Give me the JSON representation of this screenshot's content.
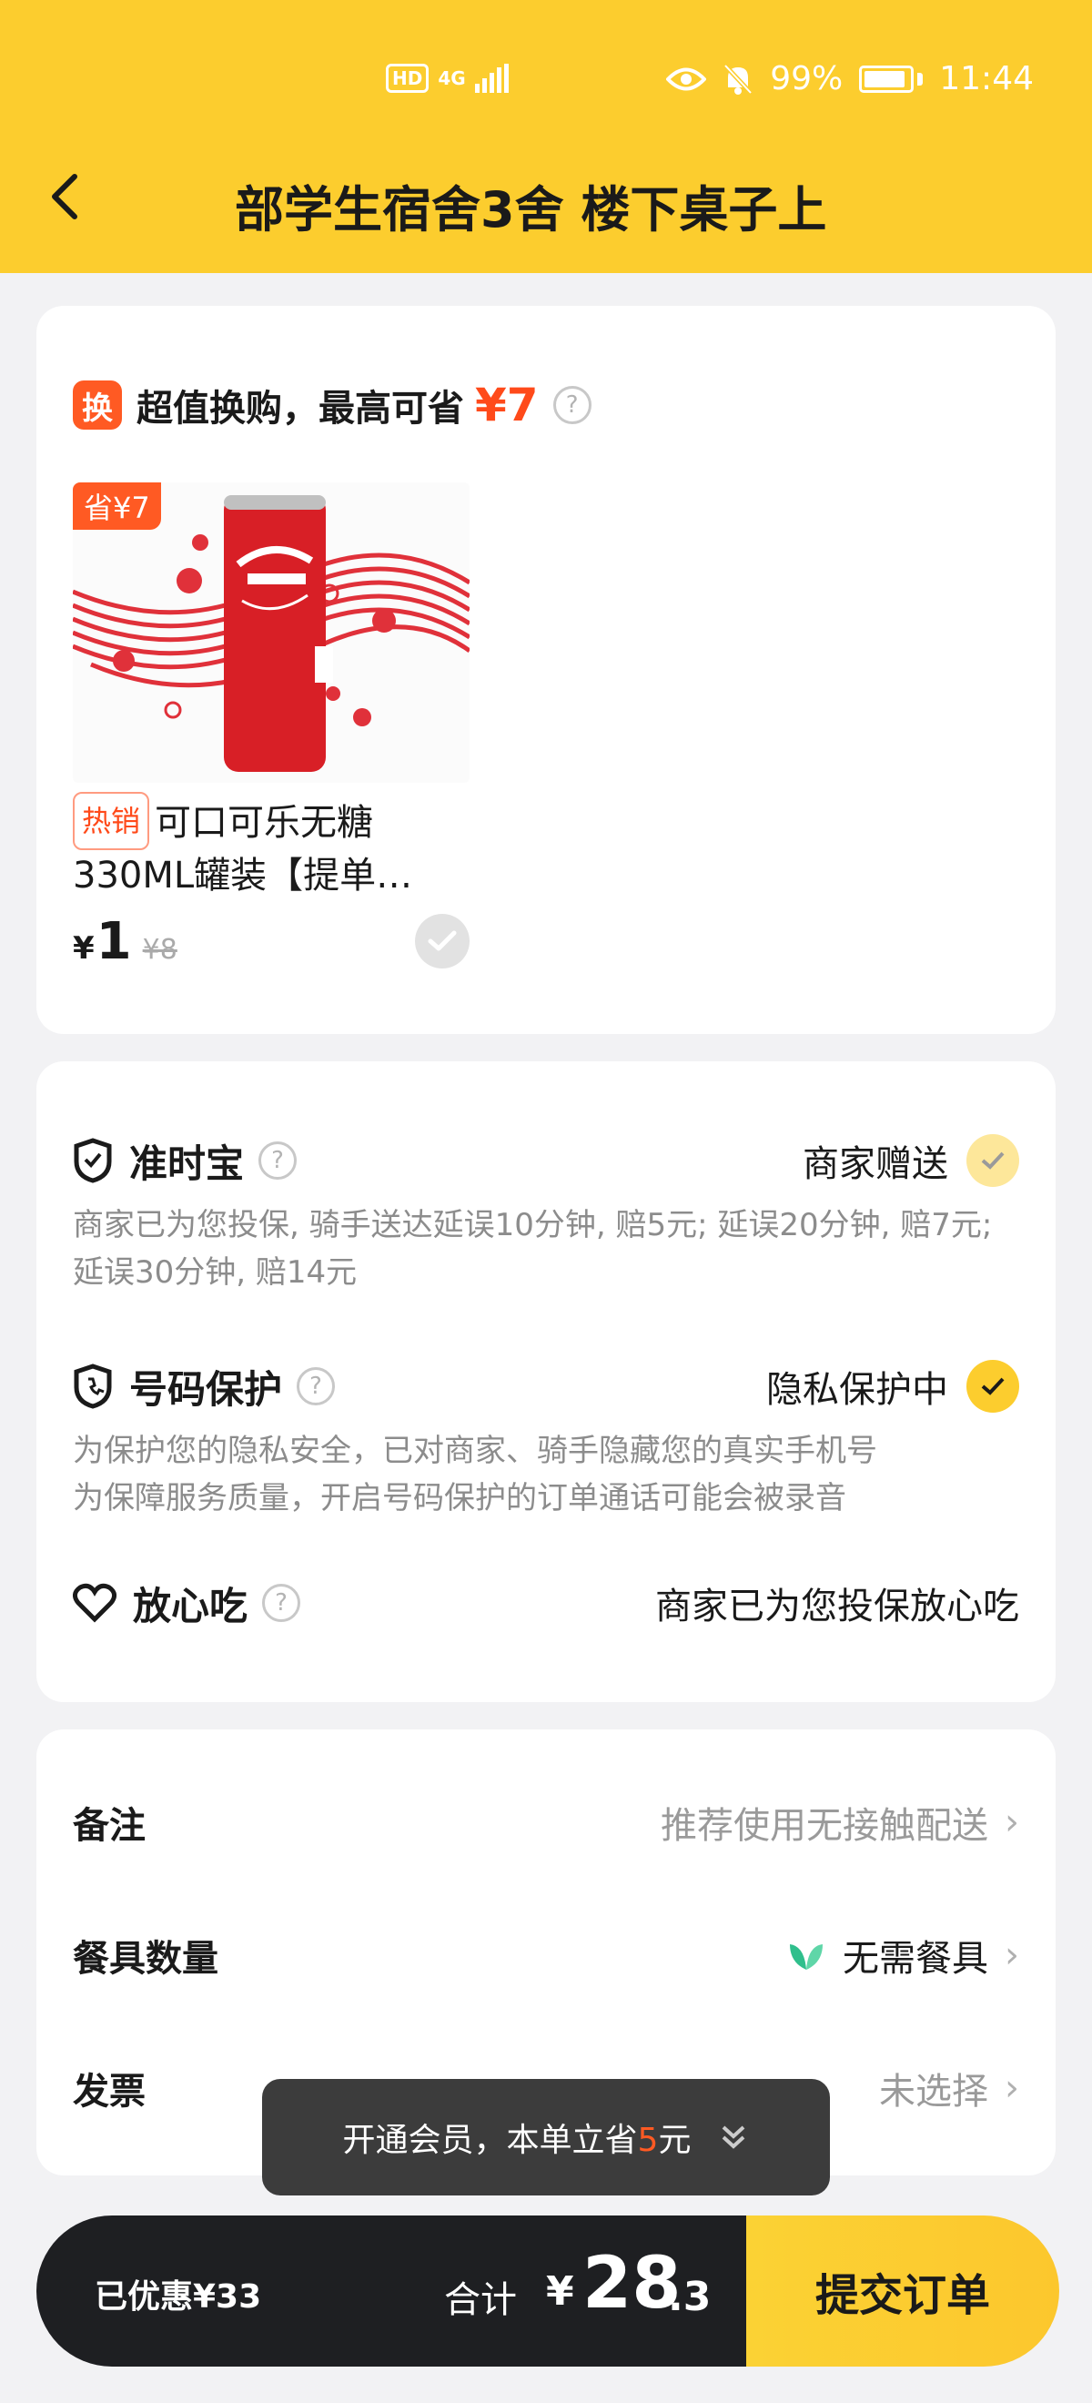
{
  "status_bar": {
    "hd": "HD",
    "net": "4G",
    "battery_pct": "99%",
    "time": "11:44"
  },
  "header": {
    "title": "部学生宿舍3舍 楼下桌子上"
  },
  "swap": {
    "tag": "换",
    "text": "超值换购，最高可省",
    "save": "¥7",
    "help": "?",
    "product": {
      "save_badge": "省¥7",
      "hot_tag": "热销",
      "name": "可口可乐无糖330ML罐装【提单…",
      "currency": "¥",
      "price": "1",
      "old_price": "¥8"
    }
  },
  "insurance": [
    {
      "title": "准时宝",
      "help": "?",
      "right": "商家赠送",
      "desc": "商家已为您投保, 骑手送达延误10分钟, 赔5元; 延误20分钟, 赔7元; 延误30分钟, 赔14元"
    },
    {
      "title": "号码保护",
      "help": "?",
      "right": "隐私保护中",
      "desc": "为保护您的隐私安全，已对商家、骑手隐藏您的真实手机号\n为保障服务质量，开启号码保护的订单通话可能会被录音"
    },
    {
      "title": "放心吃",
      "help": "?",
      "right": "商家已为您投保放心吃"
    }
  ],
  "options": {
    "remark": {
      "label": "备注",
      "value": "推荐使用无接触配送"
    },
    "tableware": {
      "label": "餐具数量",
      "value": "无需餐具"
    },
    "invoice": {
      "label": "发票",
      "value": "未选择"
    }
  },
  "toast": {
    "pre": "开通会员，本单立省",
    "amount": "5",
    "post": "元"
  },
  "bottom": {
    "discount": "已优惠¥33",
    "total_label": "合计",
    "currency": "¥",
    "total_int": "28",
    "total_dec": ".3",
    "submit": "提交订单"
  },
  "colors": {
    "brand_yellow": "#fccd2e",
    "accent_orange": "#ff5a23",
    "dark_bar": "#1e1f22"
  }
}
